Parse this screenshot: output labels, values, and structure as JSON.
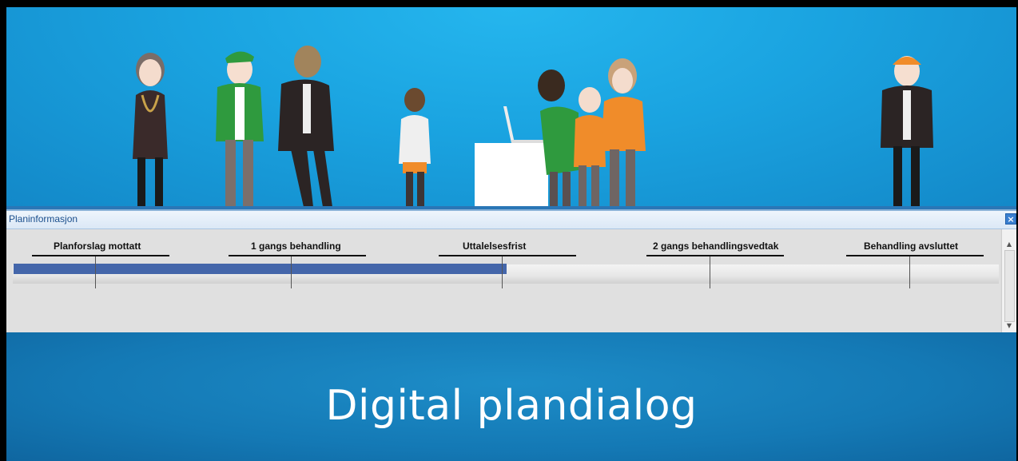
{
  "panel": {
    "title": "Planinformasjon",
    "close_icon": "close-icon"
  },
  "timeline": {
    "milestones": [
      {
        "label": "Planforslag mottatt"
      },
      {
        "label": "1 gangs behandling"
      },
      {
        "label": "Uttalelsesfrist"
      },
      {
        "label": "2 gangs behandlingsvedtak"
      },
      {
        "label": "Behandling avsluttet"
      }
    ],
    "progress_fraction": 0.5,
    "progress_color": "#4466aa"
  },
  "footer": {
    "title": "Digital plandialog"
  },
  "colors": {
    "hero_blue": "#1aa3e0",
    "footer_blue": "#1479b5"
  }
}
